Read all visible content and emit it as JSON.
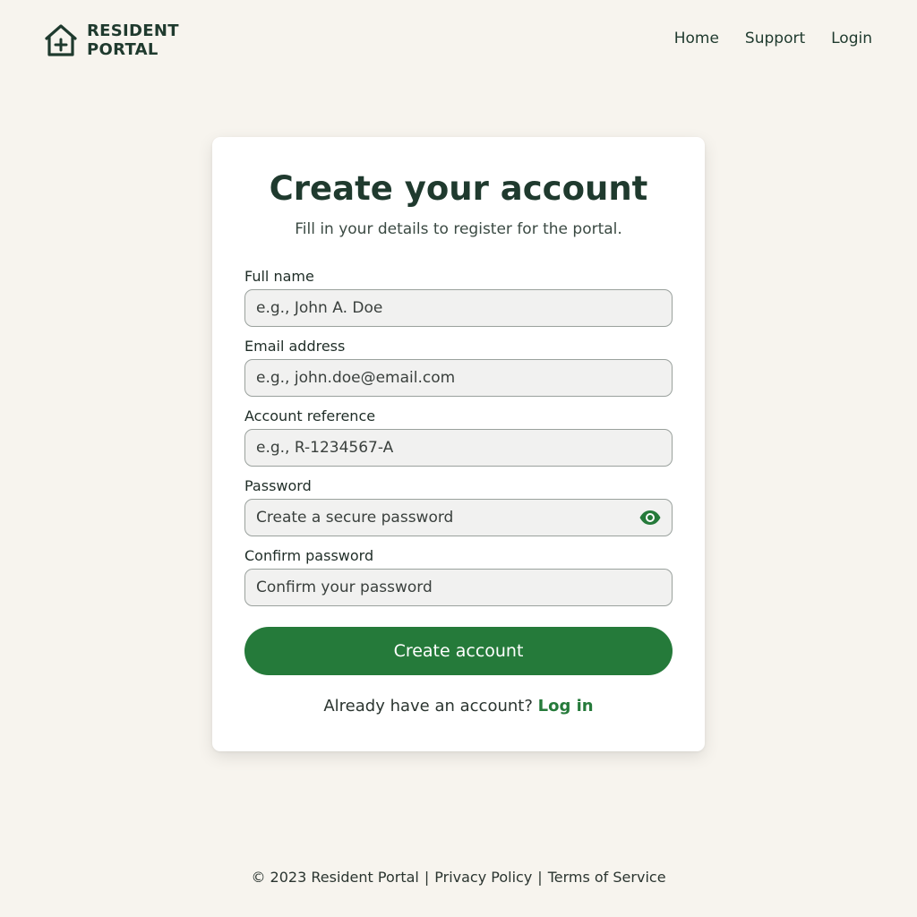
{
  "brand": {
    "line1": "RESIDENT",
    "line2": "PORTAL",
    "icon": "house-plus-icon",
    "color": "#1f3a2e"
  },
  "nav": {
    "home": "Home",
    "support": "Support",
    "login": "Login"
  },
  "form": {
    "title": "Create your account",
    "subtitle": "Fill in your details to register for the portal.",
    "fields": {
      "full_name": {
        "label": "Full name",
        "placeholder": "e.g., John A. Doe"
      },
      "email": {
        "label": "Email address",
        "placeholder": "e.g., john.doe@email.com"
      },
      "account_ref": {
        "label": "Account reference",
        "placeholder": "e.g., R-1234567-A"
      },
      "password": {
        "label": "Password",
        "placeholder": "Create a secure password",
        "icon": "eye-icon"
      },
      "confirm_password": {
        "label": "Confirm password",
        "placeholder": "Confirm your password"
      }
    },
    "submit_label": "Create account",
    "login_prompt": "Already have an account?",
    "login_link": "Log in",
    "accent_color": "#257a3a"
  },
  "footer": {
    "copyright": "© 2023 Resident Portal",
    "privacy": "Privacy Policy",
    "terms": "Terms of Service",
    "separator": "|"
  }
}
